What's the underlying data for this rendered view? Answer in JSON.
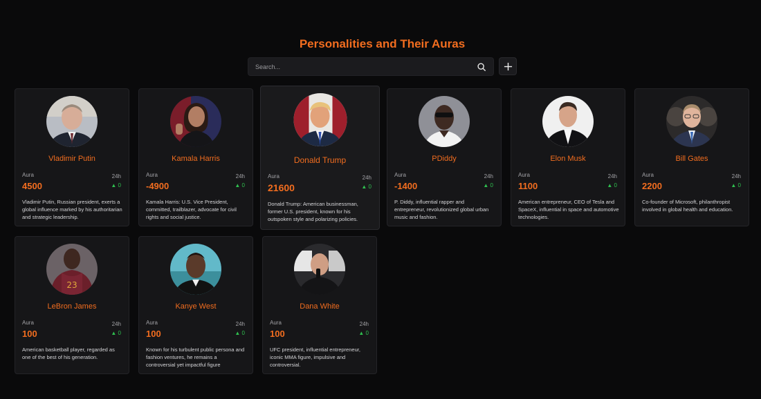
{
  "page": {
    "title": "Personalities and Their Auras"
  },
  "search": {
    "placeholder": "Search..."
  },
  "cards": [
    {
      "name": "Vladimir Putin",
      "aura_label": "Aura",
      "aura": "4500",
      "period": "24h",
      "change": "0",
      "description": "Vladimir Putin, Russian president, exerts a global influence marked by his authoritarian and strategic leadership."
    },
    {
      "name": "Kamala Harris",
      "aura_label": "Aura",
      "aura": "-4900",
      "period": "24h",
      "change": "0",
      "description": "Kamala Harris: U.S. Vice President, committed, trailblazer, advocate for civil rights and social justice."
    },
    {
      "name": "Donald Trump",
      "aura_label": "Aura",
      "aura": "21600",
      "period": "24h",
      "change": "0",
      "description": "Donald Trump: American businessman, former U.S. president, known for his outspoken style and polarizing policies."
    },
    {
      "name": "PDiddy",
      "aura_label": "Aura",
      "aura": "-1400",
      "period": "24h",
      "change": "0",
      "description": "P. Diddy, influential rapper and entrepreneur, revolutionized global urban music and fashion."
    },
    {
      "name": "Elon Musk",
      "aura_label": "Aura",
      "aura": "1100",
      "period": "24h",
      "change": "0",
      "description": "American entrepreneur, CEO of Tesla and SpaceX, influential in space and automotive technologies."
    },
    {
      "name": "Bill Gates",
      "aura_label": "Aura",
      "aura": "2200",
      "period": "24h",
      "change": "0",
      "description": "Co-founder of Microsoft, philanthropist involved in global health and education."
    },
    {
      "name": "LeBron James",
      "aura_label": "Aura",
      "aura": "100",
      "period": "24h",
      "change": "0",
      "description": "American basketball player, regarded as one of the best of his generation."
    },
    {
      "name": "Kanye West",
      "aura_label": "Aura",
      "aura": "100",
      "period": "24h",
      "change": "0",
      "description": "Known for his turbulent public persona and fashion ventures, he remains a controversial yet impactful figure"
    },
    {
      "name": "Dana White",
      "aura_label": "Aura",
      "aura": "100",
      "period": "24h",
      "change": "0",
      "description": "UFC president, influential entrepreneur, iconic MMA figure, impulsive and controversial."
    }
  ]
}
